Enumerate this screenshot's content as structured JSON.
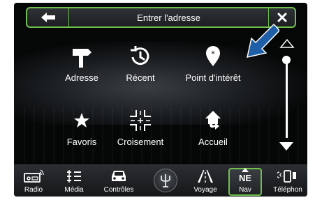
{
  "header": {
    "title": "Entrer l'adresse",
    "back_icon": "back-arrow-icon",
    "close_icon": "close-icon"
  },
  "grid": [
    {
      "label": "Adresse",
      "icon": "signpost-icon"
    },
    {
      "label": "Récent",
      "icon": "recent-clock-icon"
    },
    {
      "label": "Point d'intérêt",
      "icon": "poi-pin-icon"
    },
    {
      "label": "Favoris",
      "icon": "star-icon"
    },
    {
      "label": "Croisement",
      "icon": "intersection-icon"
    },
    {
      "label": "Accueil",
      "icon": "home-icon"
    }
  ],
  "navbar": {
    "items": [
      {
        "label": "Radio",
        "icon": "radio-icon"
      },
      {
        "label": "Média",
        "icon": "media-icon"
      },
      {
        "label": "Contrôles",
        "icon": "car-controls-icon"
      },
      {
        "label": "",
        "icon": "maserati-trident-icon"
      },
      {
        "label": "Voyage",
        "icon": "road-icon"
      },
      {
        "label": "Nav",
        "icon": "compass-icon",
        "heading": "NE",
        "active": true
      },
      {
        "label": "Téléphon",
        "icon": "phone-icon"
      }
    ]
  },
  "colors": {
    "accent": "#6fc04e",
    "annotation_arrow": "#1f5fa8",
    "background": "#050707",
    "text": "#ffffff"
  }
}
